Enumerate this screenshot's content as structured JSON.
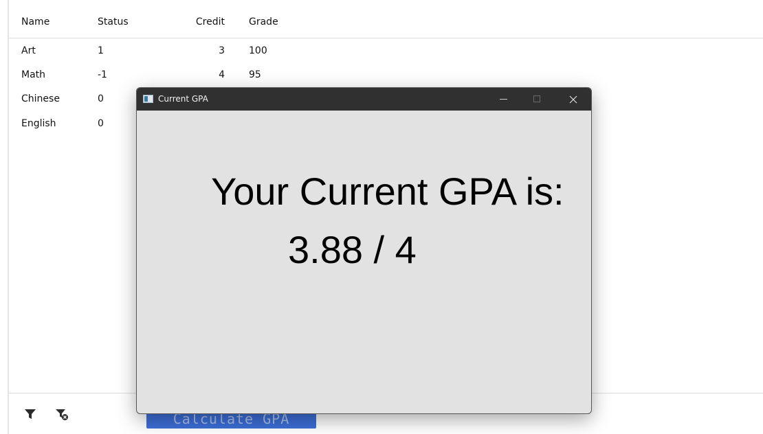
{
  "table": {
    "headers": {
      "name": "Name",
      "status": "Status",
      "credit": "Credit",
      "grade": "Grade"
    },
    "rows": [
      {
        "name": "Art",
        "status": "1",
        "credit": "3",
        "grade": "100"
      },
      {
        "name": "Math",
        "status": "-1",
        "credit": "4",
        "grade": "95"
      },
      {
        "name": "Chinese",
        "status": "0",
        "credit": "",
        "grade": ""
      },
      {
        "name": "English",
        "status": "0",
        "credit": "",
        "grade": ""
      }
    ]
  },
  "toolbar": {
    "filter_icon": "filter-icon",
    "filter_clear_icon": "filter-clear-icon",
    "calc_label": "Calculate GPA"
  },
  "dialog": {
    "title": "Current GPA",
    "message": "Your Current GPA is:",
    "value": "3.88 / 4"
  },
  "colors": {
    "accent_button": "#3c6fd8",
    "titlebar": "#303030",
    "dialog_background": "#e2e2e2"
  }
}
